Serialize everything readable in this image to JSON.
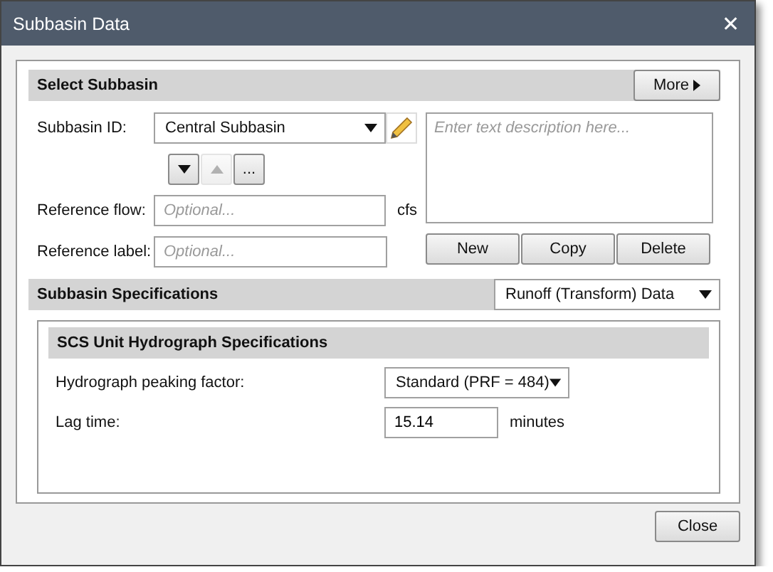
{
  "window": {
    "title": "Subbasin Data",
    "close_glyph": "✕"
  },
  "select_subbasin": {
    "title": "Select Subbasin",
    "more_button": "More",
    "subbasin_id": {
      "label": "Subbasin ID:",
      "value": "Central Subbasin"
    },
    "nav_buttons": [
      {
        "kind": "down",
        "disabled": false
      },
      {
        "kind": "up",
        "disabled": true
      },
      {
        "kind": "text",
        "label": "...",
        "disabled": false
      }
    ],
    "description": {
      "placeholder": "Enter text description here..."
    },
    "reference_flow": {
      "label": "Reference flow:",
      "placeholder": "Optional...",
      "unit": "cfs"
    },
    "reference_label": {
      "label": "Reference label:",
      "placeholder": "Optional..."
    },
    "actions": [
      "New",
      "Copy",
      "Delete"
    ]
  },
  "subbasin_specifications": {
    "title": "Subbasin Specifications",
    "view": "Runoff (Transform) Data",
    "scs": {
      "title": "SCS Unit Hydrograph Specifications",
      "peaking_factor": {
        "label": "Hydrograph peaking factor:",
        "value": "Standard (PRF = 484)"
      },
      "lag_time": {
        "label": "Lag time:",
        "value": "15.14",
        "unit": "minutes"
      }
    }
  },
  "footer": {
    "close_button": "Close"
  }
}
